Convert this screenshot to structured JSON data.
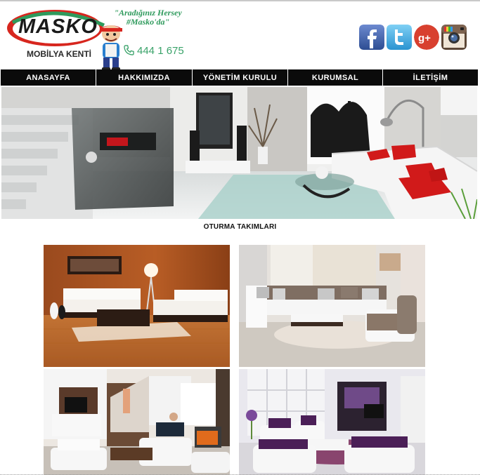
{
  "brand": {
    "logo_text": "MASKO",
    "logo_subtitle": "MOBİLYA KENTİ",
    "slogan_line1": "\"Aradığınız Hersey",
    "slogan_line2": "#Masko'da\"",
    "phone": "444 1 675"
  },
  "social": [
    {
      "name": "facebook-icon",
      "color": "#3b5998"
    },
    {
      "name": "twitter-icon",
      "color": "#3aa4dc"
    },
    {
      "name": "google-plus-icon",
      "color": "#d8402f"
    },
    {
      "name": "instagram-icon",
      "color": "#5b4636"
    }
  ],
  "nav": {
    "items": [
      {
        "label": "ANASAYFA"
      },
      {
        "label": "HAKKIMIZDA"
      },
      {
        "label": "YÖNETİM KURULU"
      },
      {
        "label": "KURUMSAL"
      },
      {
        "label": "İLETİŞİM"
      }
    ]
  },
  "section": {
    "title": "OTURMA TAKIMLARI"
  },
  "colors": {
    "nav_bg": "#0b0b0b",
    "brand_red": "#d7261e",
    "brand_green": "#2e9a5c"
  }
}
